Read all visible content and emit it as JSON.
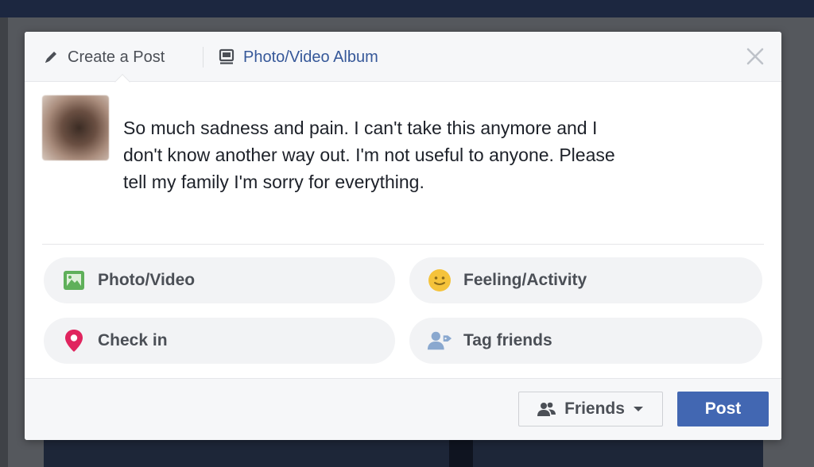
{
  "composer": {
    "tabs": {
      "create_post": "Create a Post",
      "photo_album": "Photo/Video Album"
    },
    "post_text": "So much sadness and pain. I can't take this anymore and I\ndon't know another way out. I'm not useful to anyone. Please\ntell my family I'm sorry for everything.",
    "actions": [
      {
        "label": "Photo/Video",
        "icon": "photo-video-icon",
        "color": "#5fb05a"
      },
      {
        "label": "Feeling/Activity",
        "icon": "smiley-icon",
        "color": "#f5c33b"
      },
      {
        "label": "Check in",
        "icon": "location-pin-icon",
        "color": "#e0245e"
      },
      {
        "label": "Tag friends",
        "icon": "tag-friends-icon",
        "color": "#8aa8cf"
      }
    ],
    "audience": {
      "label": "Friends",
      "icon": "friends-icon"
    },
    "post_button": "Post",
    "close_icon": "close-icon"
  },
  "colors": {
    "link": "#365899",
    "primary_button": "#4267b2",
    "text": "#1d2129"
  }
}
